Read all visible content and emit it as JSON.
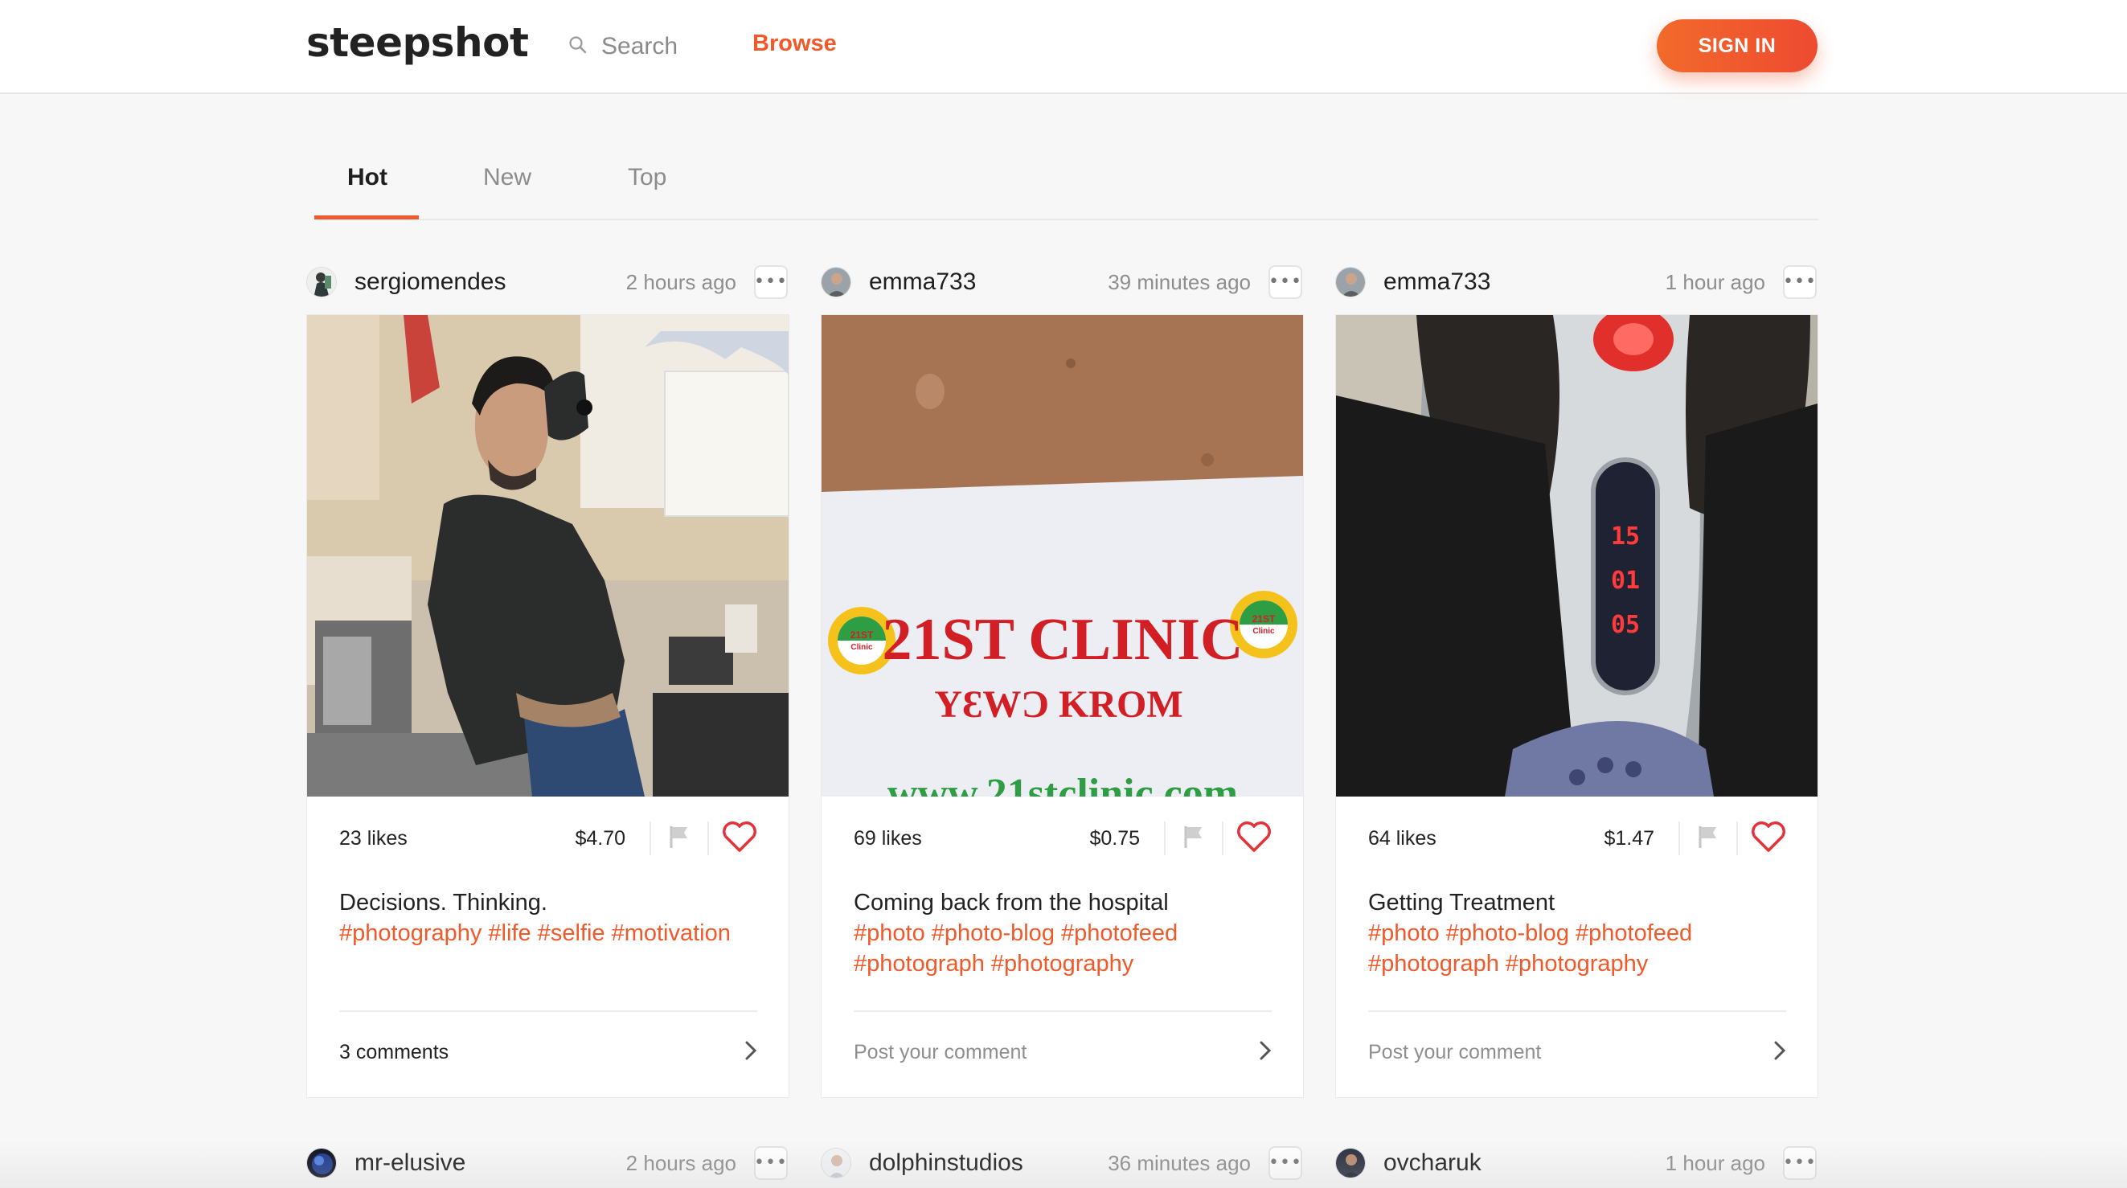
{
  "header": {
    "logo": "steepshot",
    "search_placeholder": "Search",
    "browse_label": "Browse",
    "signin_label": "SIGN IN"
  },
  "tabs": [
    "Hot",
    "New",
    "Top"
  ],
  "active_tab": "Hot",
  "accent_color": "#f1592a",
  "posts": [
    {
      "user": "sergiomendes",
      "time": "2 hours ago",
      "likes": "23 likes",
      "payout": "$4.70",
      "title": "Decisions. Thinking.",
      "tags": "#photography #life #selfie #motivation",
      "comment": "3 comments"
    },
    {
      "user": "emma733",
      "time": "39 minutes ago",
      "likes": "69 likes",
      "payout": "$0.75",
      "title": "Coming back from the hospital",
      "tags": "#photo #photo-blog #photofeed #photograph #photography",
      "comment": "Post your comment",
      "photo_sign": {
        "clinic": "21ST CLINIC",
        "sub": "YƐWƆ KROM",
        "web": "www.21stclinic.com",
        "badge_top": "21ST",
        "badge_bottom": "Clinic"
      }
    },
    {
      "user": "emma733",
      "time": "1 hour ago",
      "likes": "64 likes",
      "payout": "$1.47",
      "title": "Getting Treatment",
      "tags": "#photo #photo-blog #photofeed #photograph #photography",
      "comment": "Post your comment",
      "photo_display": [
        "15",
        "01",
        "05"
      ]
    }
  ],
  "next_row": [
    {
      "user": "mr-elusive",
      "time": "2 hours ago"
    },
    {
      "user": "dolphinstudios",
      "time": "36 minutes ago"
    },
    {
      "user": "ovcharuk",
      "time": "1 hour ago"
    }
  ]
}
